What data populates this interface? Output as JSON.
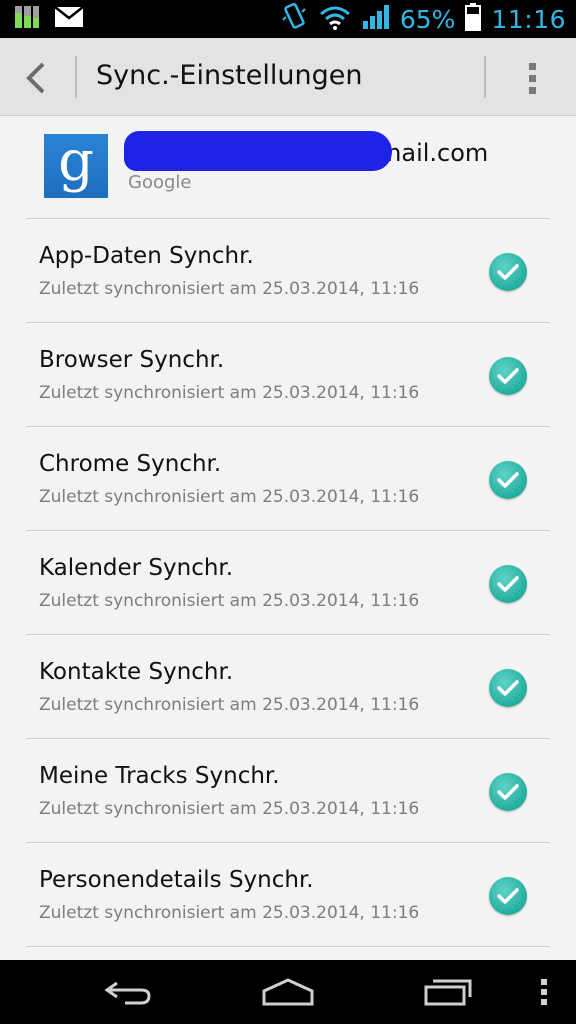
{
  "status_bar": {
    "battery": "65%",
    "time": "11:16",
    "icons": [
      "storage-icon",
      "mail-icon",
      "vibrate-icon",
      "wifi-icon",
      "signal-icon",
      "battery-icon"
    ]
  },
  "action_bar": {
    "title": "Sync.-Einstellungen",
    "back_icon": "chevron-left-icon",
    "menu_icon": "overflow-menu-icon"
  },
  "account": {
    "email_visible_suffix": "mail.com",
    "type": "Google",
    "logo_letter": "g"
  },
  "sync_items": [
    {
      "title": "App-Daten Synchr.",
      "subtitle": "Zuletzt synchronisiert am 25.03.2014, 11:16",
      "checked": true
    },
    {
      "title": "Browser Synchr.",
      "subtitle": "Zuletzt synchronisiert am 25.03.2014, 11:16",
      "checked": true
    },
    {
      "title": "Chrome Synchr.",
      "subtitle": "Zuletzt synchronisiert am 25.03.2014, 11:16",
      "checked": true
    },
    {
      "title": "Kalender Synchr.",
      "subtitle": "Zuletzt synchronisiert am 25.03.2014, 11:16",
      "checked": true
    },
    {
      "title": "Kontakte Synchr.",
      "subtitle": "Zuletzt synchronisiert am 25.03.2014, 11:16",
      "checked": true
    },
    {
      "title": "Meine Tracks Synchr.",
      "subtitle": "Zuletzt synchronisiert am 25.03.2014, 11:16",
      "checked": true
    },
    {
      "title": "Personendetails Synchr.",
      "subtitle": "Zuletzt synchronisiert am 25.03.2014, 11:16",
      "checked": true
    }
  ],
  "nav_bar": {
    "icons": [
      "back-nav-icon",
      "home-icon",
      "recent-apps-icon",
      "menu-icon"
    ]
  },
  "colors": {
    "accent": "#33b5e5",
    "check": "#2bb3a3",
    "google_blue": "#2b84d6"
  }
}
